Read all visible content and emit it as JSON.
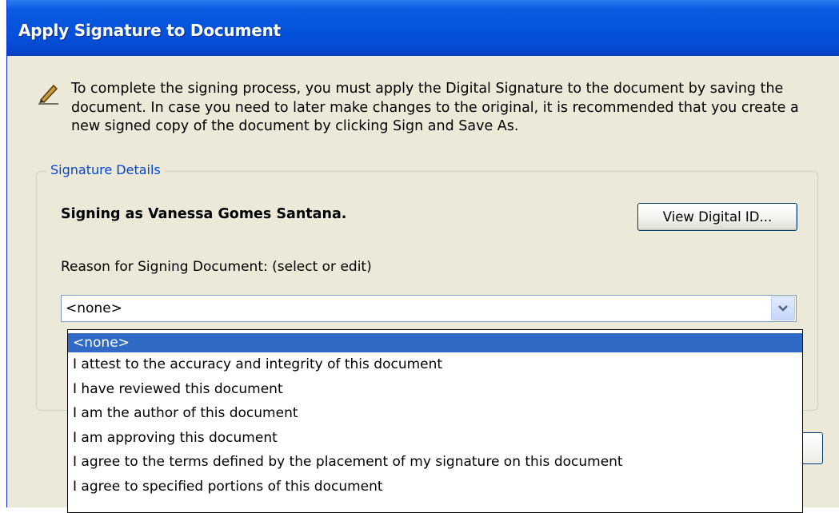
{
  "window": {
    "title": "Apply Signature to Document"
  },
  "instructions": {
    "text": "To complete the signing process, you must apply the Digital Signature to the document by saving the document. In case you need to later make changes to the original, it is recommended that you create a new signed copy of the document by clicking Sign and Save As.",
    "icon": "pen-icon"
  },
  "signature_details": {
    "legend": "Signature Details",
    "signing_as": "Signing as Vanessa Gomes Santana.",
    "view_digital_id_label": "View Digital ID...",
    "reason_label": "Reason for Signing Document: (select or edit)",
    "reason_value": "<none>",
    "reason_options": [
      "<none>",
      "I attest to the accuracy and integrity of this document",
      "I have reviewed this document",
      "I am the author of this document",
      "I am approving this document",
      "I agree to the terms defined by the placement of my signature on this document",
      "I agree to specified portions of this document"
    ],
    "selected_index": 0
  },
  "colors": {
    "title_bar": "#0553db",
    "dialog_bg": "#ece9d8",
    "legend_text": "#0046d5",
    "selection": "#316ac5"
  }
}
